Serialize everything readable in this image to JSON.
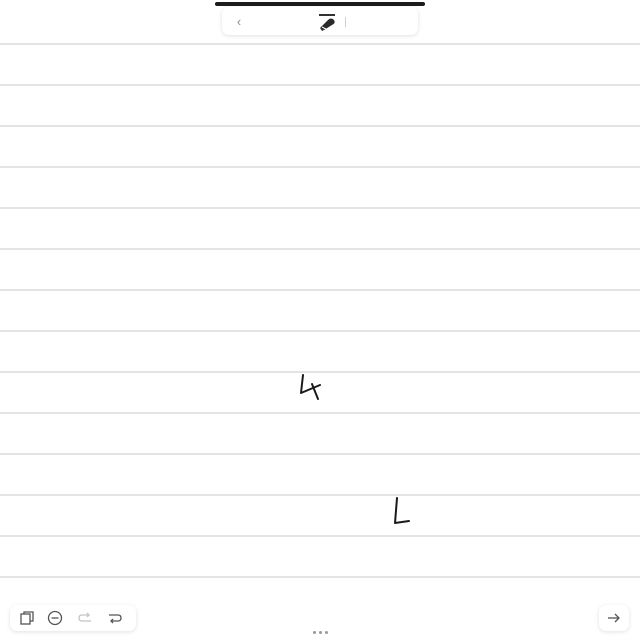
{
  "app": {
    "accent_color": "#1c1c1c",
    "paper_color": "#ffffff",
    "rule_color": "#e4e4e4"
  },
  "top_toolbar": {
    "back_icon": "chevron-left-icon",
    "back_glyph": "‹",
    "tool_icon": "pen-eraser-icon"
  },
  "canvas": {
    "style": "lined-paper",
    "ink_marks": [
      {
        "name": "handwritten-4",
        "glyph": "4"
      },
      {
        "name": "handwritten-L",
        "glyph": "L"
      }
    ]
  },
  "bottom_toolbar": {
    "items": [
      {
        "name": "pages-icon",
        "enabled": true
      },
      {
        "name": "zoom-out-icon",
        "enabled": true
      },
      {
        "name": "undo-icon",
        "enabled": false
      },
      {
        "name": "redo-icon",
        "enabled": true
      }
    ],
    "next_icon": "arrow-right-icon",
    "more_icon": "more-dots-icon"
  }
}
